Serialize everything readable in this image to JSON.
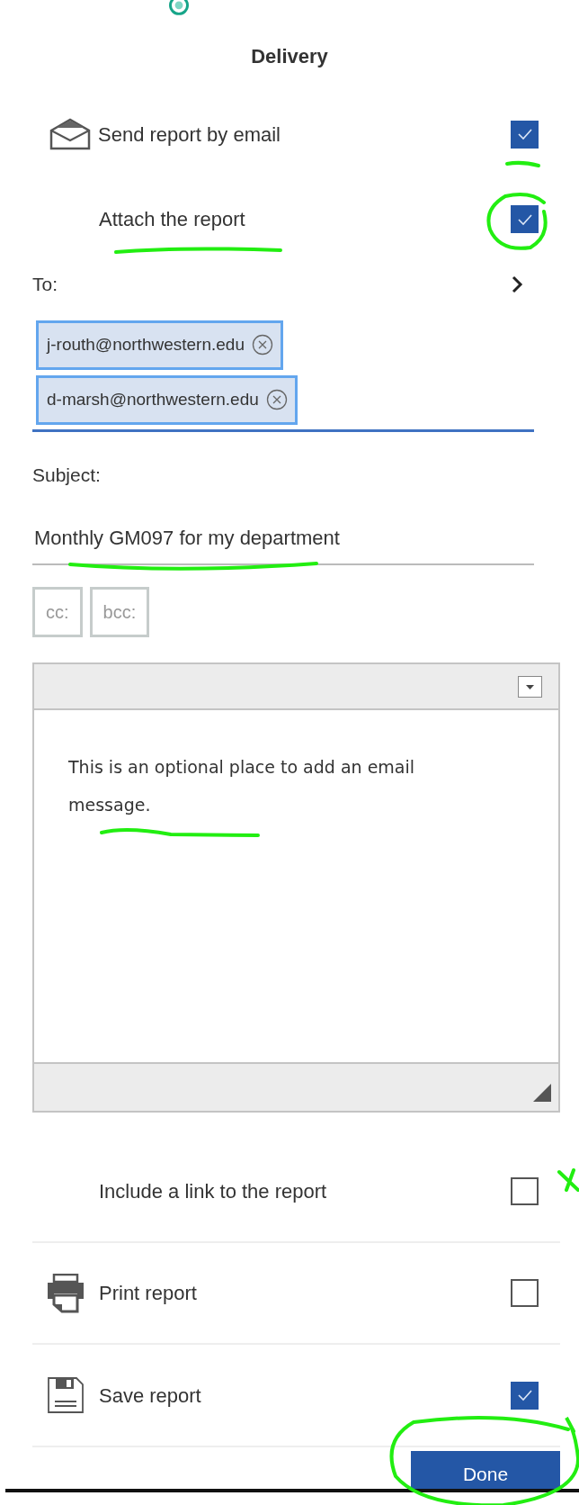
{
  "header": {
    "title": "Delivery"
  },
  "email_option": {
    "label": "Send report by email",
    "checked": true
  },
  "attach_option": {
    "label": "Attach the report",
    "checked": true
  },
  "to": {
    "label": "To:",
    "chips": [
      {
        "text": "j-routh@northwestern.edu"
      },
      {
        "text": "d-marsh@northwestern.edu"
      }
    ]
  },
  "subject": {
    "label": "Subject:",
    "value": "Monthly GM097 for my department"
  },
  "copy_buttons": [
    "cc:",
    "bcc:"
  ],
  "message": {
    "value": "This is an optional place to add an email message."
  },
  "options": [
    {
      "kind": "plain",
      "label": "Include a link to the report",
      "checked": false
    },
    {
      "kind": "print",
      "label": "Print report",
      "checked": false
    },
    {
      "kind": "save",
      "label": "Save report",
      "checked": true
    }
  ],
  "done_button": "Done"
}
